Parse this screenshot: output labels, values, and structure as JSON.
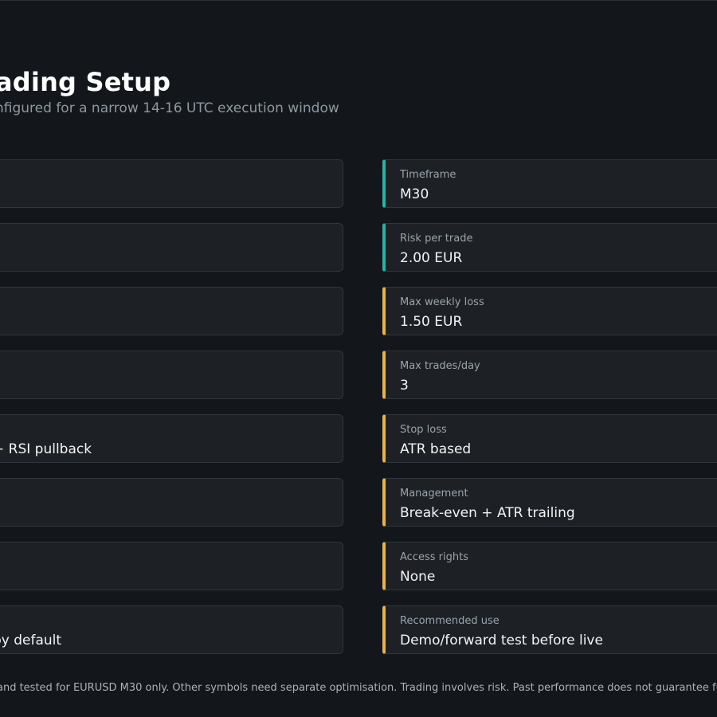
{
  "header": {
    "title": "ading Setup",
    "subtitle": "nfigured for a narrow 14-16 UTC execution window"
  },
  "left_cards": [
    {
      "label": "",
      "value": ""
    },
    {
      "label": "",
      "value": ""
    },
    {
      "label": "",
      "value": ""
    },
    {
      "label": "",
      "value": ""
    },
    {
      "label": "",
      "value": "+ RSI pullback"
    },
    {
      "label": "",
      "value": ""
    },
    {
      "label": "",
      "value": ""
    },
    {
      "label": "",
      "value": "by default"
    }
  ],
  "right_cards": [
    {
      "label": "Timeframe",
      "value": "M30",
      "status": "ok"
    },
    {
      "label": "Risk per trade",
      "value": "2.00 EUR",
      "status": "ok"
    },
    {
      "label": "Max weekly loss",
      "value": "1.50 EUR",
      "status": "warn"
    },
    {
      "label": "Max trades/day",
      "value": "3",
      "status": "warn"
    },
    {
      "label": "Stop loss",
      "value": "ATR based",
      "status": "warn"
    },
    {
      "label": "Management",
      "value": "Break-even + ATR trailing",
      "status": "warn"
    },
    {
      "label": "Access rights",
      "value": "None",
      "status": "warn"
    },
    {
      "label": "Recommended use",
      "value": "Demo/forward test before live",
      "status": "warn"
    }
  ],
  "footer": {
    "note": "and tested for EURUSD M30 only. Other symbols need separate optimisation. Trading involves risk. Past performance does not guarantee future"
  },
  "colors": {
    "background": "#13171b",
    "card_background": "#1d2126",
    "ok_accent": "#27b3a6",
    "warn_accent": "#e8b24a"
  }
}
